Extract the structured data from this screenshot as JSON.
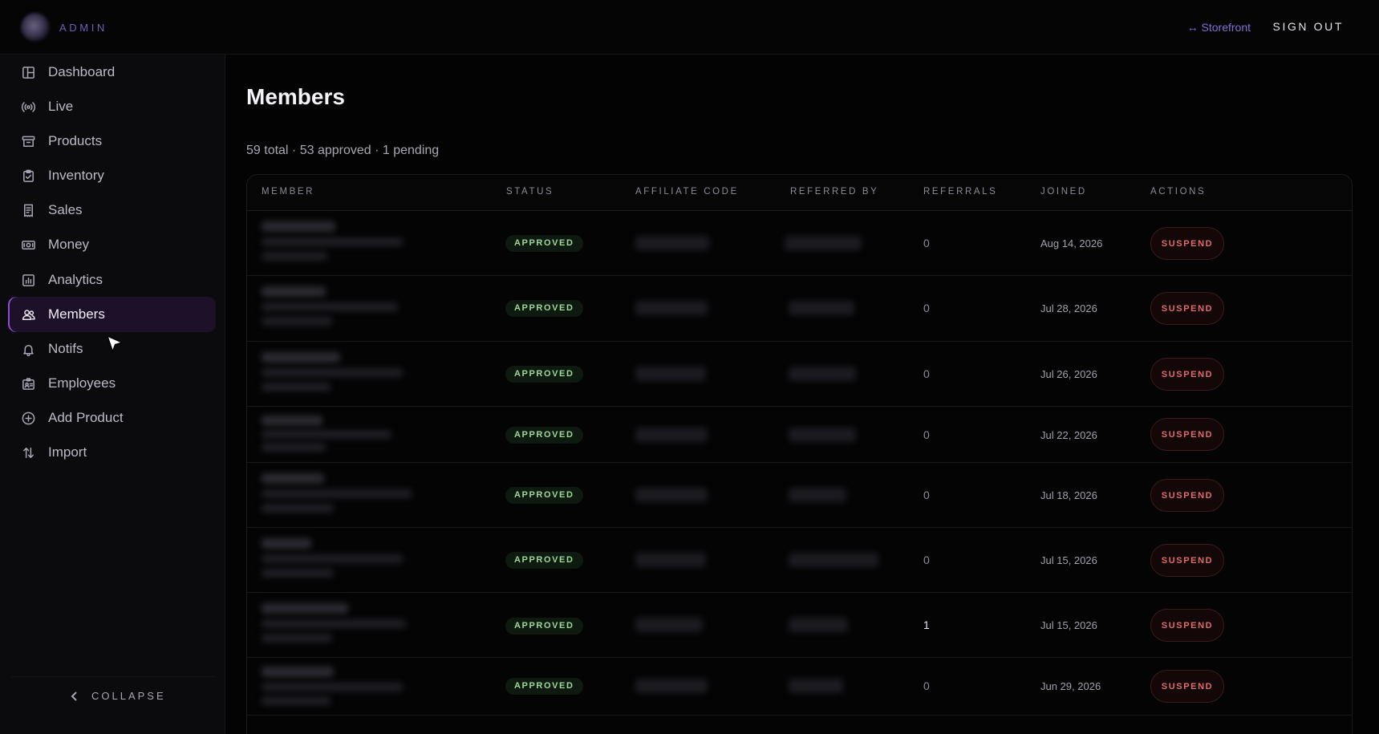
{
  "header": {
    "brand": "ADMIN",
    "storefront_link": "↔ Storefront",
    "signout_label": "SIGN OUT"
  },
  "sidebar": {
    "items": [
      {
        "label": "Dashboard",
        "icon": "dashboard-icon"
      },
      {
        "label": "Live",
        "icon": "live-broadcast-icon"
      },
      {
        "label": "Products",
        "icon": "archive-box-icon"
      },
      {
        "label": "Inventory",
        "icon": "clipboard-check-icon"
      },
      {
        "label": "Sales",
        "icon": "receipt-icon"
      },
      {
        "label": "Money",
        "icon": "cash-icon"
      },
      {
        "label": "Analytics",
        "icon": "bar-chart-icon"
      },
      {
        "label": "Members",
        "icon": "users-icon",
        "active": true
      },
      {
        "label": "Notifs",
        "icon": "bell-icon"
      },
      {
        "label": "Employees",
        "icon": "id-badge-icon"
      },
      {
        "label": "Add Product",
        "icon": "plus-circle-icon"
      },
      {
        "label": "Import",
        "icon": "import-arrows-icon"
      }
    ],
    "collapse_label": "COLLAPSE"
  },
  "main": {
    "title": "Members",
    "summary": "59 total · 53 approved · 1 pending",
    "columns": [
      "MEMBER",
      "STATUS",
      "AFFILIATE CODE",
      "REFERRED BY",
      "REFERRALS",
      "JOINED",
      "ACTIONS"
    ],
    "rows": [
      {
        "status": "APPROVED",
        "referrals": "0",
        "joined": "Aug 14, 2026",
        "action": "SUSPEND"
      },
      {
        "status": "APPROVED",
        "referrals": "0",
        "joined": "Jul 28, 2026",
        "action": "SUSPEND"
      },
      {
        "status": "APPROVED",
        "referrals": "0",
        "joined": "Jul 26, 2026",
        "action": "SUSPEND"
      },
      {
        "status": "APPROVED",
        "referrals": "0",
        "joined": "Jul 22, 2026",
        "action": "SUSPEND"
      },
      {
        "status": "APPROVED",
        "referrals": "0",
        "joined": "Jul 18, 2026",
        "action": "SUSPEND"
      },
      {
        "status": "APPROVED",
        "referrals": "0",
        "joined": "Jul 15, 2026",
        "action": "SUSPEND"
      },
      {
        "status": "APPROVED",
        "referrals": "1",
        "joined": "Jul 15, 2026",
        "action": "SUSPEND"
      },
      {
        "status": "APPROVED",
        "referrals": "0",
        "joined": "Jun 29, 2026",
        "action": "SUSPEND"
      }
    ]
  },
  "colors": {
    "accent": "#8a4fd6",
    "brand": "#6f5fb8",
    "approved": "#9ed79a",
    "danger": "#e06b6b"
  }
}
